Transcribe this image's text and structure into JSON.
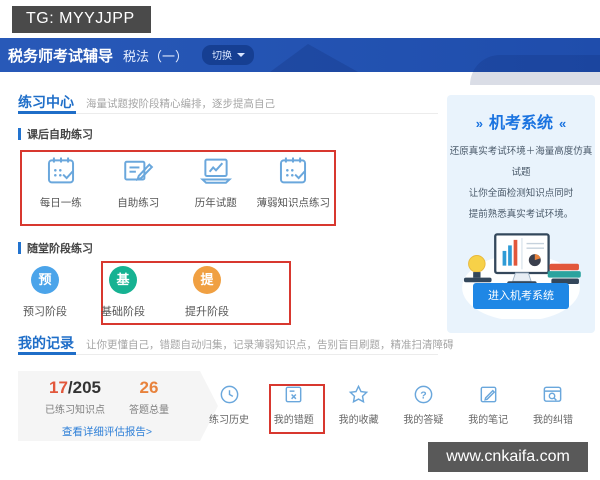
{
  "watermarks": {
    "top": "TG: MYYJJPP",
    "bottom": "www.cnkaifa.com"
  },
  "header": {
    "brand": "税务师考试辅导",
    "subject": "税法（一）",
    "switch_label": "切换"
  },
  "practice_center": {
    "title": "练习中心",
    "subtitle": "海量试题按阶段精心编排，逐步提高自己",
    "self_practice": {
      "label": "课后自助练习",
      "items": [
        {
          "label": "每日一练",
          "icon": "calendar-check-icon"
        },
        {
          "label": "自助练习",
          "icon": "doc-pencil-icon"
        },
        {
          "label": "历年试题",
          "icon": "laptop-chart-icon"
        },
        {
          "label": "薄弱知识点练习",
          "icon": "calendar-check-icon"
        }
      ]
    },
    "stage_practice": {
      "label": "随堂阶段练习",
      "items": [
        {
          "badge": "预",
          "label": "预习阶段",
          "color": "#4ba4ea"
        },
        {
          "badge": "基",
          "label": "基础阶段",
          "color": "#16b292"
        },
        {
          "badge": "提",
          "label": "提升阶段",
          "color": "#f0a042"
        }
      ]
    }
  },
  "my_records": {
    "title": "我的记录",
    "subtitle": "让你更懂自己，错题自动归集，记录薄弱知识点，告别盲目刷题，精准扫清障碍",
    "stats": [
      {
        "value": "17",
        "suffix": "/205",
        "label": "已练习知识点"
      },
      {
        "value": "26",
        "suffix": "",
        "label": "答题总量"
      }
    ],
    "report_link": "查看详细评估报告>",
    "actions": [
      {
        "label": "练习历史",
        "icon": "clock-icon"
      },
      {
        "label": "我的错题",
        "icon": "doc-x-icon",
        "highlighted": true
      },
      {
        "label": "我的收藏",
        "icon": "star-icon"
      },
      {
        "label": "我的答疑",
        "icon": "question-icon"
      },
      {
        "label": "我的笔记",
        "icon": "note-pencil-icon"
      },
      {
        "label": "我的纠错",
        "icon": "search-doc-icon"
      }
    ]
  },
  "exam_system": {
    "deco_left": "»",
    "deco_right": "«",
    "title": "机考系统",
    "lines": [
      "还原真实考试环境＋海量高度仿真试题",
      "让你全面检测知识点同时",
      "提前熟悉真实考试环境。"
    ],
    "button_label": "进入机考系统"
  },
  "colors": {
    "header_blue": "#2456b0",
    "accent_blue": "#1f6ec8",
    "highlight_red": "#d8382f",
    "stat_orange": "#e2573b",
    "panel_bg": "#e9f3fc",
    "button_blue": "#1f87e5"
  }
}
